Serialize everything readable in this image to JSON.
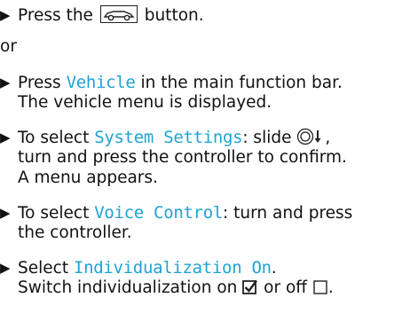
{
  "bullet": "▶",
  "step1": {
    "pre": "Press the",
    "post": "button.",
    "icon": "vehicle-button-icon"
  },
  "or": "or",
  "step2": {
    "pre": "Press",
    "keyword": "Vehicle",
    "post": "in the main function bar.",
    "line2": "The vehicle menu is displayed."
  },
  "step3": {
    "pre": "To select",
    "keyword": "System Settings",
    "post": ": slide",
    "icon": "controller-slide-down-icon",
    "line2": "turn and press the controller to confirm.",
    "line3": "A menu appears."
  },
  "step4": {
    "pre": "To select",
    "keyword": "Voice Control",
    "post": ": turn and press",
    "line2": "the controller."
  },
  "step5": {
    "pre": "Select",
    "keyword": "Individualization On",
    "post": ".",
    "line2_pre": "Switch individualization on",
    "line2_mid": "or off",
    "line2_post": ".",
    "checked_icon": "checkbox-checked-icon",
    "unchecked_icon": "checkbox-unchecked-icon"
  },
  "colors": {
    "keyword": "#1ea3d4",
    "text": "#111111"
  }
}
